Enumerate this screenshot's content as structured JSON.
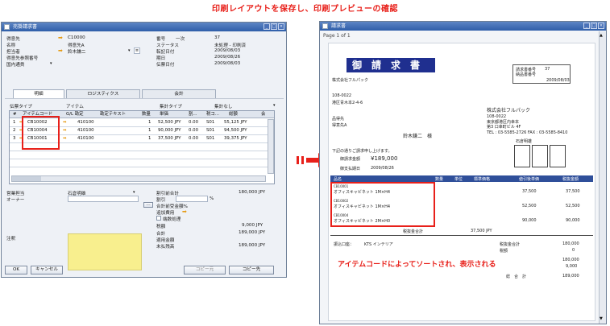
{
  "banner": "印刷レイアウトを保存し、印刷プレビューの確認",
  "left_window": {
    "title": "売掛請求書",
    "header_left": [
      {
        "label": "得意先",
        "value": "C10000",
        "arrow": true
      },
      {
        "label": "名称",
        "value": "得意先A",
        "arrow": false
      },
      {
        "label": "担当者",
        "value": "鈴木鎌二",
        "arrow": true
      },
      {
        "label": "得意先参照番号",
        "value": "",
        "arrow": false
      },
      {
        "label": "国内通貨",
        "value": "",
        "arrow": false
      }
    ],
    "header_right": [
      {
        "label": "番号",
        "mid": "一次",
        "value": "37"
      },
      {
        "label": "ステータス",
        "mid": "",
        "value": "未処理 - 印刷済"
      },
      {
        "label": "転記日付",
        "mid": "",
        "value": "2009/08/03"
      },
      {
        "label": "期日",
        "mid": "",
        "value": "2009/08/26"
      },
      {
        "label": "伝票日付",
        "mid": "",
        "value": "2009/08/03"
      }
    ],
    "tabs": [
      "明細",
      "ロジスティクス",
      "会計"
    ],
    "type_row": {
      "label1": "伝票タイプ",
      "value1": "アイテム",
      "label2": "集計タイプ",
      "value2": "集計なし"
    },
    "columns": [
      "#",
      "アイテムコード",
      "G/L 勘定",
      "勘定テキスト",
      "数量",
      "単価",
      "割...",
      "税コ...",
      "総額",
      "会"
    ],
    "rows": [
      {
        "no": "1",
        "code": "CB10002",
        "gl": "410100",
        "qty": "1",
        "price": "52,500 JPY",
        "disc": "0.00",
        "tax": "S01",
        "total": "55,125 JPY"
      },
      {
        "no": "2",
        "code": "CB10004",
        "gl": "410100",
        "qty": "1",
        "price": "90,000 JPY",
        "disc": "0.00",
        "tax": "S01",
        "total": "94,500 JPY"
      },
      {
        "no": "3",
        "code": "CB10001",
        "gl": "410100",
        "qty": "1",
        "price": "37,500 JPY",
        "disc": "0.00",
        "tax": "S01",
        "total": "39,375 JPY"
      }
    ],
    "footer_left": [
      {
        "label": "営業担当",
        "value": "石倉明雄"
      },
      {
        "label": "オーナー",
        "value": ""
      }
    ],
    "remarks_label": "注釈",
    "totals": [
      {
        "label": "割引前合計",
        "value": "180,000 JPY"
      },
      {
        "label": "割引",
        "value": "%"
      },
      {
        "label": "合計前受金額%",
        "value": ""
      },
      {
        "label": "追加費用",
        "value": ""
      },
      {
        "label": "端数処理",
        "value": ""
      },
      {
        "label": "税額",
        "value": "9,000 JPY"
      },
      {
        "label": "合計",
        "value": "189,000 JPY"
      },
      {
        "label": "適用金額",
        "value": ""
      },
      {
        "label": "未払残高",
        "value": "189,000 JPY"
      }
    ],
    "buttons": {
      "ok": "OK",
      "cancel": "キャンセル",
      "copy_from": "コピー元",
      "copy_to": "コピー先"
    }
  },
  "right_window": {
    "title": "請求書",
    "page_indicator": "Page 1 of 1",
    "doc_title": "御請求書",
    "customer_name": "株式会社フルパック",
    "doc_no_label": "請求書番号",
    "doc_no": "37",
    "date_label": "納品書番号",
    "date": "2009/08/03",
    "addr_zip": "108-0022",
    "addr_line": "港区青木本2-4-6",
    "company": "株式会社フルパック",
    "company_addr": [
      "108-0022",
      "東京都港区内幸本",
      "第3 口幸町ビル 4F"
    ],
    "company_tel": "TEL : 03-5585-2726   FAX : 03-5585-8410",
    "seal_label": "石倉明雄",
    "customer_label": "品得先",
    "customer_value": "得意先A",
    "person": "鈴木鎌二　様",
    "intro": "下記の通りご請求申し上げます。",
    "amount_label": "御請求金額",
    "amount": "¥189,000",
    "due_label": "御支払期日",
    "due": "2009/08/26",
    "table_head": [
      "品名",
      "数量",
      "単位",
      "標準価格",
      "値引後単価",
      "税抜金額"
    ],
    "items": [
      {
        "code": "CB10001",
        "name": "オフィスキャビネット 1M×H4",
        "price": "37,500",
        "amount": "37,500"
      },
      {
        "code": "CB10002",
        "name": "オフィスキャビネット 1M×H4",
        "price": "52,500",
        "amount": "52,500"
      },
      {
        "code": "CB10004",
        "name": "オフィスキャビネット 2M×H0",
        "price": "90,000",
        "amount": "90,000"
      }
    ],
    "subtotal_label": "税抜金合計",
    "subtotal": "37,500 JPY",
    "bank_label": "振込口座：",
    "bank_value": "KTS インテリア",
    "tax_total_label": "税抜金合計",
    "tax_total": "180,000",
    "tax_label": "税額",
    "tax_value": "9,000",
    "grand_label": "総　合　計",
    "grand_total": "189,000",
    "total_lines": [
      "180,000",
      "0",
      "180,000",
      "9,000"
    ]
  },
  "note": "アイテムコードによってソートされ、表示される"
}
